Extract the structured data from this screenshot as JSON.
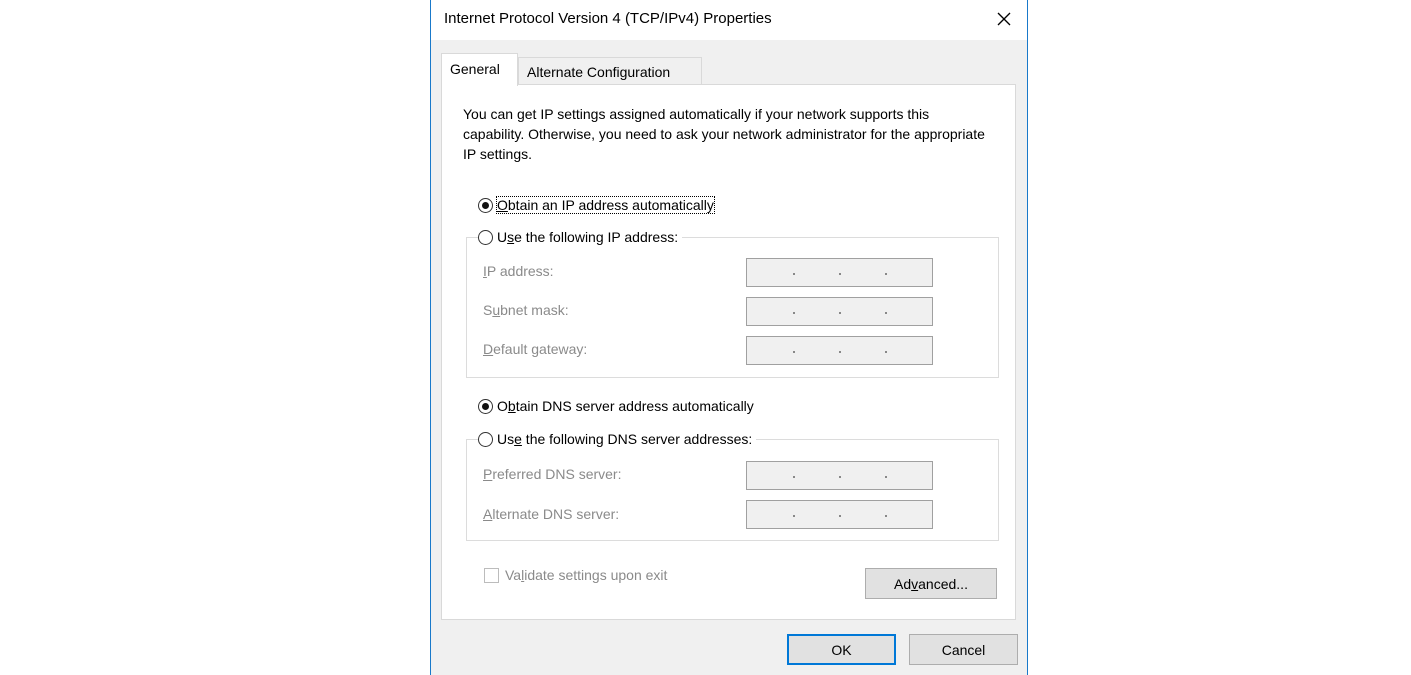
{
  "window": {
    "title": "Internet Protocol Version 4 (TCP/IPv4) Properties"
  },
  "tabs": [
    {
      "label": "General",
      "active": true
    },
    {
      "label": "Alternate Configuration",
      "active": false
    }
  ],
  "intro_text": "You can get IP settings assigned automatically if your network supports this capability. Otherwise, you need to ask your network administrator for the appropriate IP settings.",
  "ip_section": {
    "auto_option": {
      "prefix": "",
      "mnemonic": "O",
      "suffix": "btain an IP address automatically",
      "checked": true
    },
    "manual_option": {
      "prefix": "U",
      "mnemonic": "s",
      "suffix": "e the following IP address:",
      "checked": false
    },
    "fields": [
      {
        "prefix": "",
        "mnemonic": "I",
        "suffix": "P address:",
        "value": "   .   .   ."
      },
      {
        "prefix": "S",
        "mnemonic": "u",
        "suffix": "bnet mask:",
        "value": "   .   .   ."
      },
      {
        "prefix": "",
        "mnemonic": "D",
        "suffix": "efault gateway:",
        "value": "   .   .   ."
      }
    ]
  },
  "dns_section": {
    "auto_option": {
      "prefix": "O",
      "mnemonic": "b",
      "suffix": "tain DNS server address automatically",
      "checked": true
    },
    "manual_option": {
      "prefix": "Us",
      "mnemonic": "e",
      "suffix": " the following DNS server addresses:",
      "checked": false
    },
    "fields": [
      {
        "prefix": "",
        "mnemonic": "P",
        "suffix": "referred DNS server:",
        "value": "   .   .   ."
      },
      {
        "prefix": "",
        "mnemonic": "A",
        "suffix": "lternate DNS server:",
        "value": "   .   .   ."
      }
    ]
  },
  "validate_checkbox": {
    "prefix": "Va",
    "mnemonic": "l",
    "suffix": "idate settings upon exit",
    "checked": false
  },
  "buttons": {
    "advanced": {
      "prefix": "Ad",
      "mnemonic": "v",
      "suffix": "anced..."
    },
    "ok": "OK",
    "cancel": "Cancel"
  },
  "colors": {
    "accent": "#0078d7",
    "border": "#1979ca",
    "dialog_bg": "#f0f0f0",
    "disabled_text": "#8a8a8a"
  },
  "icons": {
    "close": "close-icon"
  }
}
